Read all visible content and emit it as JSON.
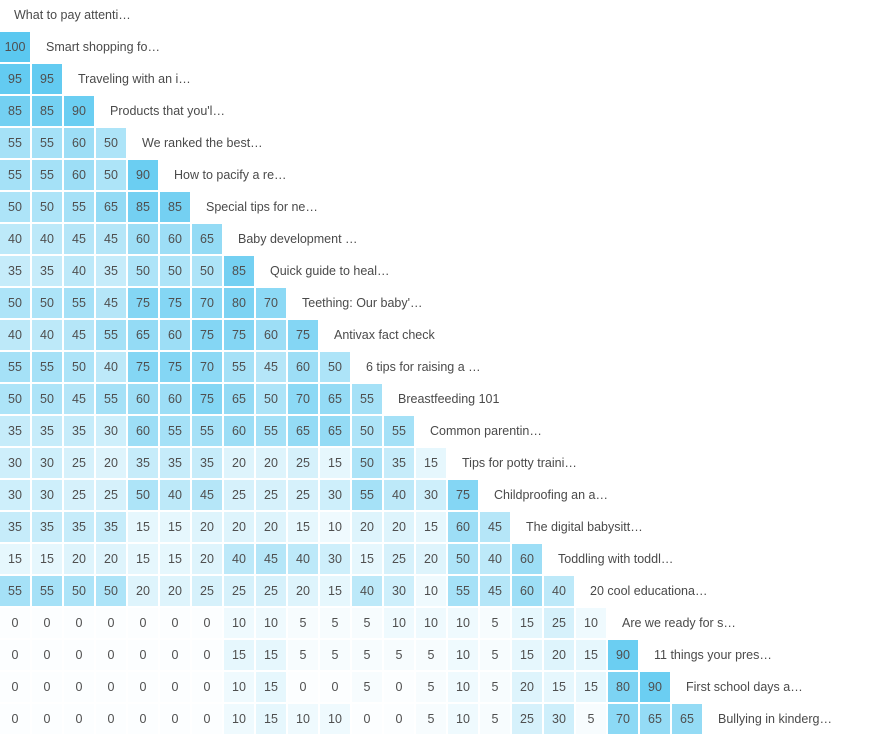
{
  "chart_data": {
    "type": "heatmap",
    "title": "",
    "subtitle": "",
    "xlabel": "",
    "ylabel": "",
    "layout": "lower-triangular",
    "grid": false,
    "legend": "none",
    "value_range": [
      0,
      100
    ],
    "value_unit": "",
    "colorscale": {
      "low": "#ffffff",
      "high": "#5bc8f0",
      "zero_cell": "#fcfeff",
      "max_cell": "#6ed0f5"
    },
    "categories": [
      "What to pay attenti…",
      "Smart shopping fo…",
      "Traveling with an i…",
      "Products that you'l…",
      "We ranked the best…",
      "How to pacify a re…",
      "Special tips for ne…",
      "Baby development …",
      "Quick guide to heal…",
      "Teething: Our baby'…",
      "Antivax fact check",
      "6 tips for raising a …",
      "Breastfeeding 101",
      "Common parentin…",
      "Tips for potty traini…",
      "Childproofing an a…",
      "The digital babysitt…",
      "Toddling with toddl…",
      "20 cool educationa…",
      "Are we ready for s…",
      "11 things your pres…",
      "First school days a…",
      "Bullying in kinderg…"
    ],
    "rows": [
      {
        "label": "What to pay attenti…",
        "values": []
      },
      {
        "label": "Smart shopping fo…",
        "values": [
          100
        ]
      },
      {
        "label": "Traveling with an i…",
        "values": [
          95,
          95
        ]
      },
      {
        "label": "Products that you'l…",
        "values": [
          85,
          85,
          90
        ]
      },
      {
        "label": "We ranked the best…",
        "values": [
          55,
          55,
          60,
          50
        ]
      },
      {
        "label": "How to pacify a re…",
        "values": [
          55,
          55,
          60,
          50,
          90
        ]
      },
      {
        "label": "Special tips for ne…",
        "values": [
          50,
          50,
          55,
          65,
          85,
          85
        ]
      },
      {
        "label": "Baby development …",
        "values": [
          40,
          40,
          45,
          45,
          60,
          60,
          65
        ]
      },
      {
        "label": "Quick guide to heal…",
        "values": [
          35,
          35,
          40,
          35,
          50,
          50,
          50,
          85
        ]
      },
      {
        "label": "Teething: Our baby'…",
        "values": [
          50,
          50,
          55,
          45,
          75,
          75,
          70,
          80,
          70
        ]
      },
      {
        "label": "Antivax fact check",
        "values": [
          40,
          40,
          45,
          55,
          65,
          60,
          75,
          75,
          60,
          75
        ]
      },
      {
        "label": "6 tips for raising a …",
        "values": [
          55,
          55,
          50,
          40,
          75,
          75,
          70,
          55,
          45,
          60,
          50
        ]
      },
      {
        "label": "Breastfeeding 101",
        "values": [
          50,
          50,
          45,
          55,
          60,
          60,
          75,
          65,
          50,
          70,
          65,
          55
        ]
      },
      {
        "label": "Common parentin…",
        "values": [
          35,
          35,
          35,
          30,
          60,
          55,
          55,
          60,
          55,
          65,
          65,
          50,
          55
        ]
      },
      {
        "label": "Tips for potty traini…",
        "values": [
          30,
          30,
          25,
          20,
          35,
          35,
          35,
          20,
          20,
          25,
          15,
          50,
          35,
          15
        ]
      },
      {
        "label": "Childproofing an a…",
        "values": [
          30,
          30,
          25,
          25,
          50,
          40,
          45,
          25,
          25,
          25,
          30,
          55,
          40,
          30,
          75
        ]
      },
      {
        "label": "The digital babysitt…",
        "values": [
          35,
          35,
          35,
          35,
          15,
          15,
          20,
          20,
          20,
          15,
          10,
          20,
          20,
          15,
          60,
          45
        ]
      },
      {
        "label": "Toddling with toddl…",
        "values": [
          15,
          15,
          20,
          20,
          15,
          15,
          20,
          40,
          45,
          40,
          30,
          15,
          25,
          20,
          50,
          40,
          60
        ]
      },
      {
        "label": "20 cool educationa…",
        "values": [
          55,
          55,
          50,
          50,
          20,
          20,
          25,
          25,
          25,
          20,
          15,
          40,
          30,
          10,
          55,
          45,
          60,
          40
        ]
      },
      {
        "label": "Are we ready for s…",
        "values": [
          0,
          0,
          0,
          0,
          0,
          0,
          0,
          10,
          10,
          5,
          5,
          5,
          10,
          10,
          10,
          5,
          15,
          25,
          10
        ]
      },
      {
        "label": "11 things your pres…",
        "values": [
          0,
          0,
          0,
          0,
          0,
          0,
          0,
          15,
          15,
          5,
          5,
          5,
          5,
          5,
          10,
          5,
          15,
          20,
          15,
          90
        ]
      },
      {
        "label": "First school days a…",
        "values": [
          0,
          0,
          0,
          0,
          0,
          0,
          0,
          10,
          15,
          0,
          0,
          5,
          0,
          5,
          10,
          5,
          20,
          15,
          15,
          80,
          90
        ]
      },
      {
        "label": "Bullying in kinderg…",
        "values": [
          0,
          0,
          0,
          0,
          0,
          0,
          0,
          10,
          15,
          10,
          10,
          0,
          0,
          5,
          10,
          5,
          25,
          30,
          5,
          70,
          65,
          65
        ]
      }
    ]
  }
}
